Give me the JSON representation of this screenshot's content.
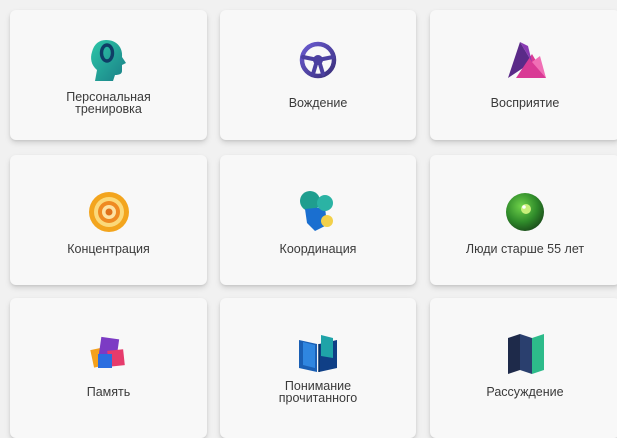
{
  "tiles": [
    {
      "id": "personal-training",
      "label": "Персональная\nтренировка",
      "icon": "head-profile-icon"
    },
    {
      "id": "driving",
      "label": "Вождение",
      "icon": "steering-wheel-icon"
    },
    {
      "id": "perception",
      "label": "Восприятие",
      "icon": "prism-icon"
    },
    {
      "id": "concentration",
      "label": "Концентрация",
      "icon": "target-icon"
    },
    {
      "id": "coordination",
      "label": "Координация",
      "icon": "coordination-shapes-icon"
    },
    {
      "id": "seniors",
      "label": "Люди старше 55 лет",
      "icon": "green-orb-icon"
    },
    {
      "id": "memory",
      "label": "Память",
      "icon": "stacked-cards-icon"
    },
    {
      "id": "reading",
      "label": "Понимание\nпрочитанного",
      "icon": "open-book-icon"
    },
    {
      "id": "reasoning",
      "label": "Рассуждение",
      "icon": "folded-map-icon"
    }
  ],
  "colors": {
    "background": "#f1f1f1",
    "tile": "#f8f8f8",
    "text": "#3a3a3a"
  }
}
